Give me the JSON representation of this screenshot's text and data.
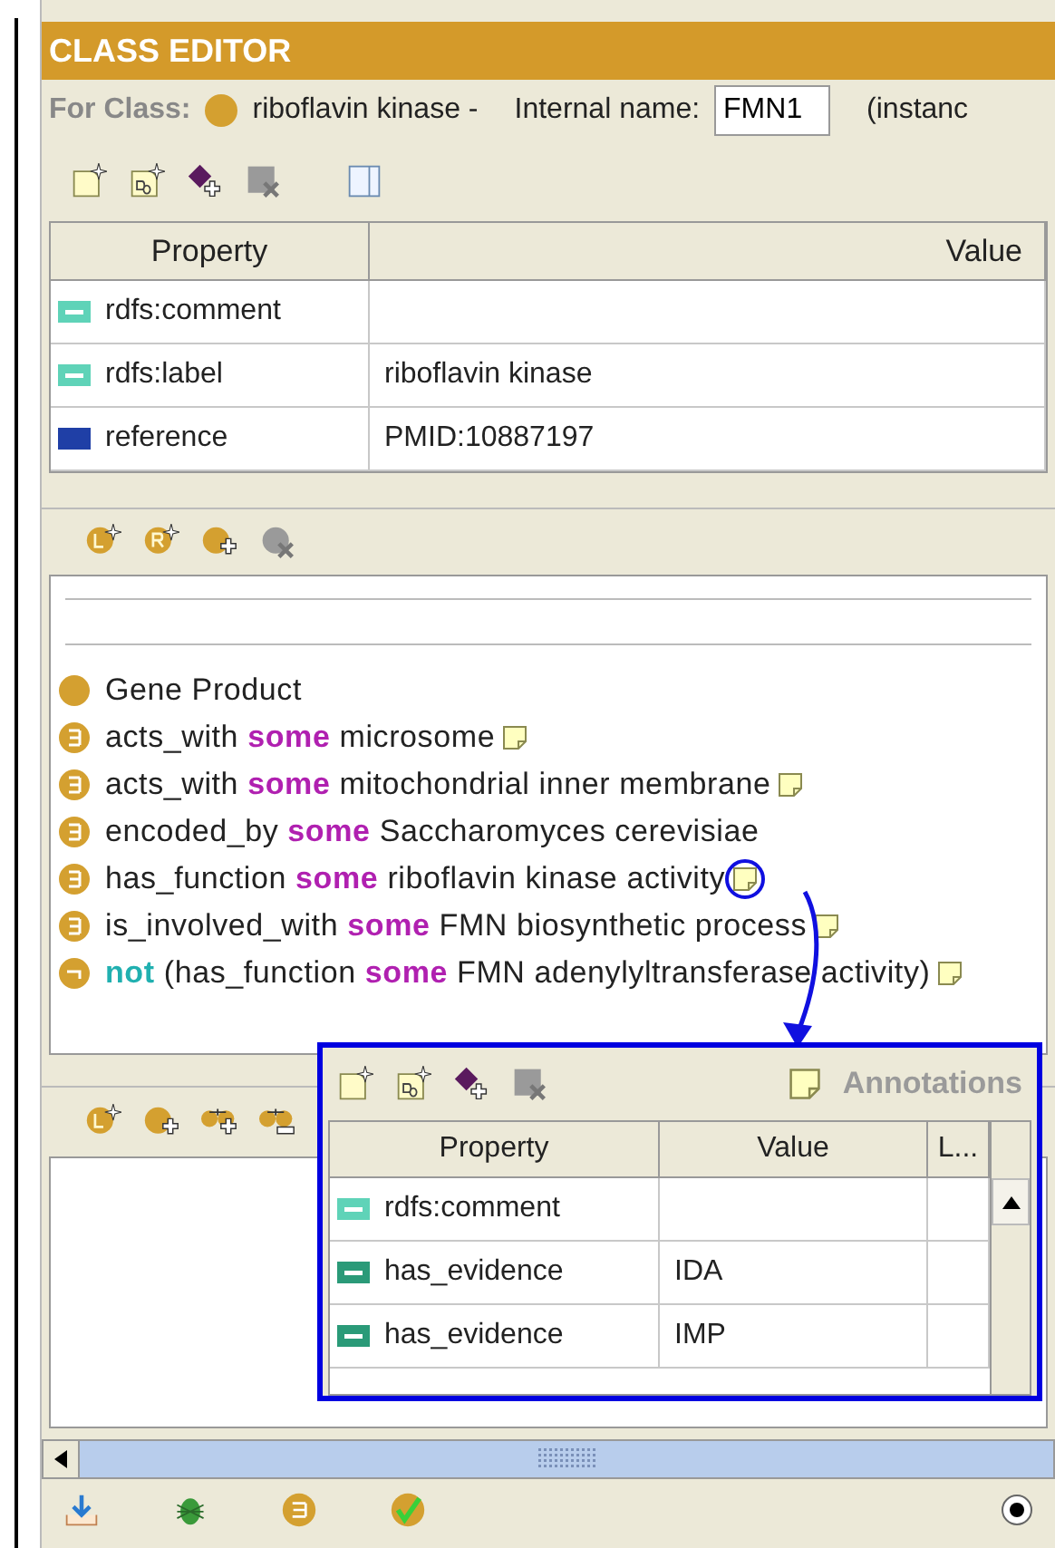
{
  "window": {
    "title": "CLASS EDITOR"
  },
  "class_header": {
    "label": "For Class:",
    "class_name": "riboflavin kinase -",
    "internal_name_label": "Internal name:",
    "internal_name": "FMN1",
    "extra": "(instanc"
  },
  "properties_table": {
    "columns": [
      "Property",
      "Value"
    ],
    "rows": [
      {
        "kind": "annotation",
        "property": "rdfs:comment",
        "value": ""
      },
      {
        "kind": "annotation",
        "property": "rdfs:label",
        "value": "riboflavin kinase"
      },
      {
        "kind": "object",
        "property": "reference",
        "value": "PMID:10887197"
      }
    ]
  },
  "conditions": [
    {
      "kind": "class",
      "annotated": false,
      "parts": [
        {
          "kind": "plain",
          "text": "Gene Product"
        }
      ]
    },
    {
      "kind": "some",
      "annotated": true,
      "parts": [
        {
          "kind": "plain",
          "text": "acts_with"
        },
        {
          "kind": "keyword",
          "text": "some"
        },
        {
          "kind": "plain",
          "text": "microsome"
        }
      ]
    },
    {
      "kind": "some",
      "annotated": true,
      "parts": [
        {
          "kind": "plain",
          "text": "acts_with"
        },
        {
          "kind": "keyword",
          "text": "some"
        },
        {
          "kind": "plain",
          "text": "mitochondrial inner membrane"
        }
      ]
    },
    {
      "kind": "some",
      "annotated": false,
      "parts": [
        {
          "kind": "plain",
          "text": "encoded_by"
        },
        {
          "kind": "keyword",
          "text": "some"
        },
        {
          "kind": "plain",
          "text": "Saccharomyces cerevisiae"
        }
      ]
    },
    {
      "kind": "some",
      "annotated": true,
      "highlighted": true,
      "parts": [
        {
          "kind": "plain",
          "text": "has_function"
        },
        {
          "kind": "keyword",
          "text": "some"
        },
        {
          "kind": "plain",
          "text": "riboflavin kinase activity"
        }
      ]
    },
    {
      "kind": "some",
      "annotated": true,
      "parts": [
        {
          "kind": "plain",
          "text": "is_involved_with"
        },
        {
          "kind": "keyword",
          "text": "some"
        },
        {
          "kind": "plain",
          "text": "FMN biosynthetic process"
        }
      ]
    },
    {
      "kind": "not",
      "annotated": true,
      "parts": [
        {
          "kind": "negation",
          "text": "not"
        },
        {
          "kind": "plain",
          "text": "(has_function"
        },
        {
          "kind": "keyword",
          "text": "some"
        },
        {
          "kind": "plain",
          "text": "FMN adenylyltransferase activity)"
        }
      ]
    }
  ],
  "annotations_popup": {
    "title": "Annotations",
    "columns": [
      "Property",
      "Value",
      "L..."
    ],
    "rows": [
      {
        "kind": "annotation",
        "property": "rdfs:comment",
        "value": ""
      },
      {
        "kind": "datatype",
        "property": "has_evidence",
        "value": "IDA"
      },
      {
        "kind": "datatype",
        "property": "has_evidence",
        "value": "IMP"
      }
    ]
  },
  "status_radio": {
    "checked": true
  }
}
